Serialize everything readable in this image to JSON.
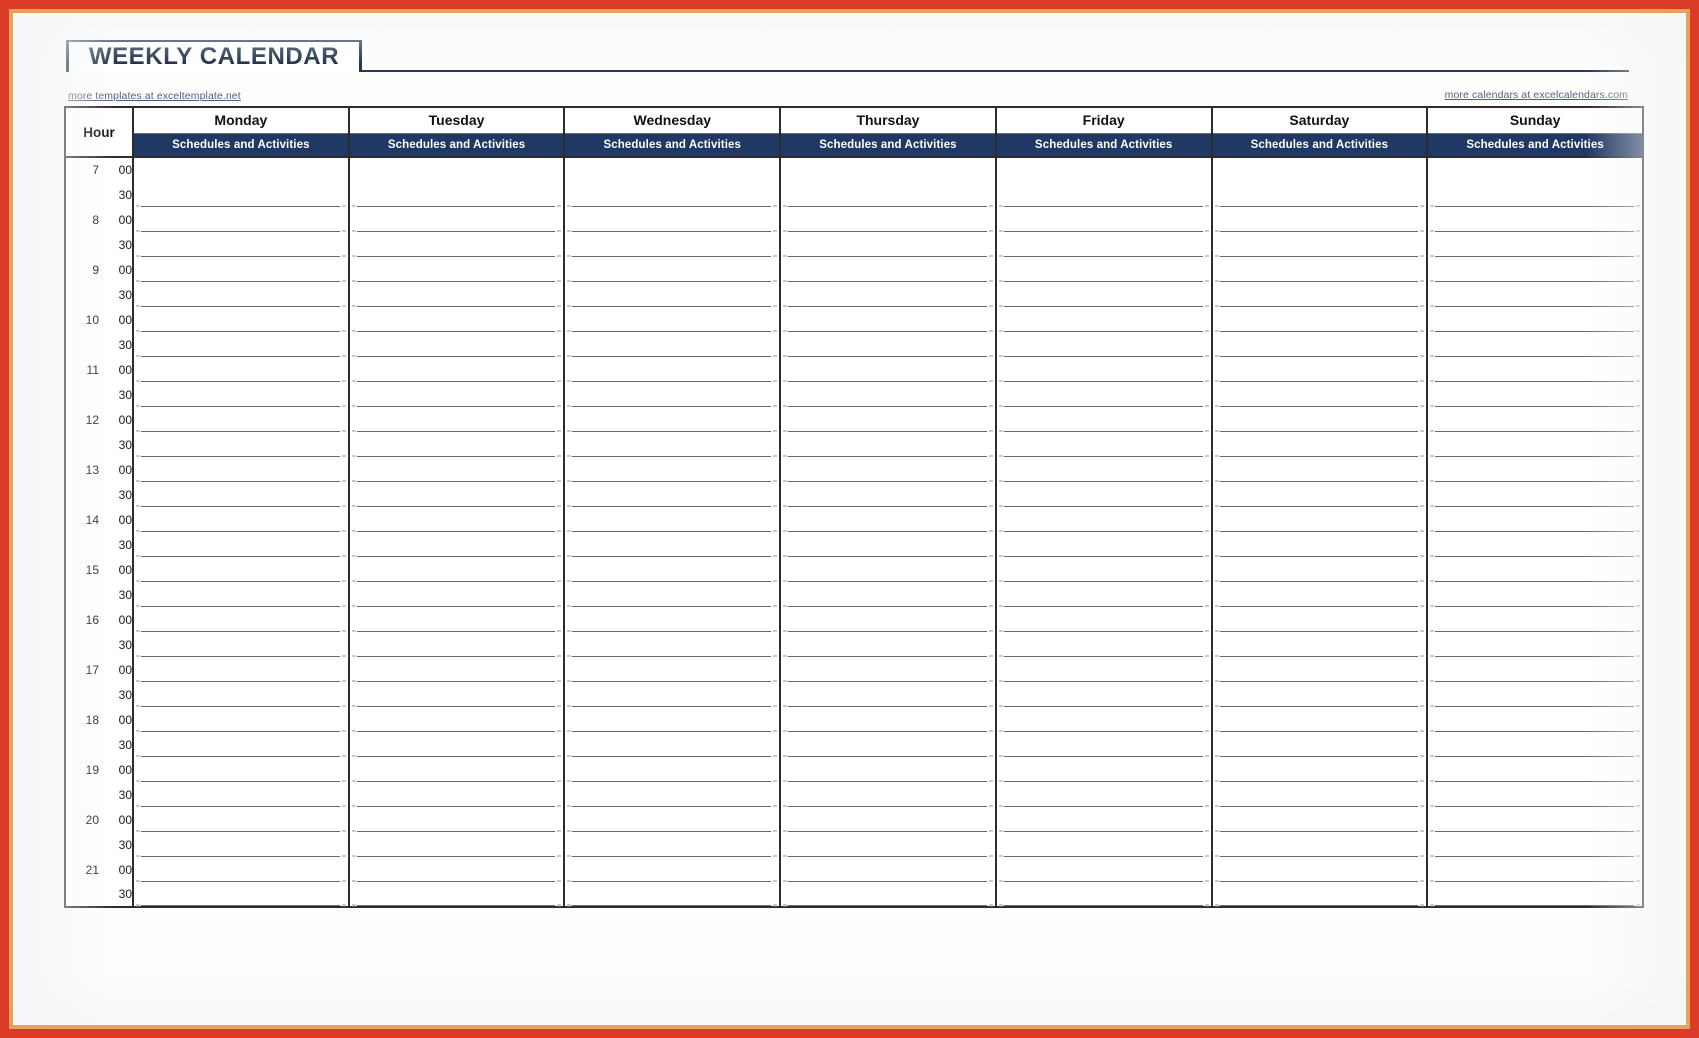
{
  "document": {
    "title": "WEEKLY CALENDAR",
    "page_frame_color": "#d93b26",
    "accent_navy": "#1f3864",
    "title_color": "#24364d"
  },
  "attribution": {
    "left_link": "more templates at exceltemplate.net",
    "right_link": "more calendars at excelcalendars.com"
  },
  "table": {
    "hour_header": "Hour",
    "day_subheader": "Schedules and Activities",
    "days": [
      "Monday",
      "Tuesday",
      "Wednesday",
      "Thursday",
      "Friday",
      "Saturday",
      "Sunday"
    ],
    "rows": [
      {
        "hour": "7",
        "minute": "00"
      },
      {
        "hour": "",
        "minute": "30"
      },
      {
        "hour": "8",
        "minute": "00"
      },
      {
        "hour": "",
        "minute": "30"
      },
      {
        "hour": "9",
        "minute": "00"
      },
      {
        "hour": "",
        "minute": "30"
      },
      {
        "hour": "10",
        "minute": "00"
      },
      {
        "hour": "",
        "minute": "30"
      },
      {
        "hour": "11",
        "minute": "00"
      },
      {
        "hour": "",
        "minute": "30"
      },
      {
        "hour": "12",
        "minute": "00"
      },
      {
        "hour": "",
        "minute": "30"
      },
      {
        "hour": "13",
        "minute": "00"
      },
      {
        "hour": "",
        "minute": "30"
      },
      {
        "hour": "14",
        "minute": "00"
      },
      {
        "hour": "",
        "minute": "30"
      },
      {
        "hour": "15",
        "minute": "00"
      },
      {
        "hour": "",
        "minute": "30"
      },
      {
        "hour": "16",
        "minute": "00"
      },
      {
        "hour": "",
        "minute": "30"
      },
      {
        "hour": "17",
        "minute": "00"
      },
      {
        "hour": "",
        "minute": "30"
      },
      {
        "hour": "18",
        "minute": "00"
      },
      {
        "hour": "",
        "minute": "30"
      },
      {
        "hour": "19",
        "minute": "00"
      },
      {
        "hour": "",
        "minute": "30"
      },
      {
        "hour": "20",
        "minute": "00"
      },
      {
        "hour": "",
        "minute": "30"
      },
      {
        "hour": "21",
        "minute": "00"
      },
      {
        "hour": "",
        "minute": "30"
      }
    ],
    "cell_values": []
  }
}
